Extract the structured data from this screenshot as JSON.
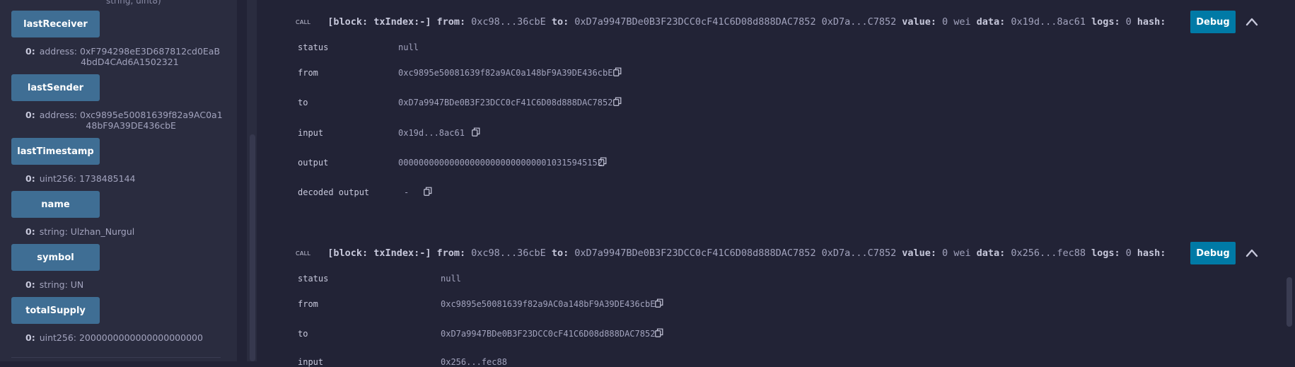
{
  "left_panel": {
    "top_cut_text": "string, uint8)",
    "functions": [
      {
        "label": "lastReceiver",
        "type_prefix": "0:",
        "output_line1": "address: 0xF794298eE3D687812cd0EaB",
        "output_line2": "4bdD4CAd6A1502321"
      },
      {
        "label": "lastSender",
        "type_prefix": "0:",
        "output_line1": "address: 0xc9895e50081639f82a9AC0a1",
        "output_line2": "48bF9A39DE436cbE"
      },
      {
        "label": "lastTimestamp",
        "type_prefix": "0:",
        "output_line1": "uint256: 1738485144"
      },
      {
        "label": "name",
        "type_prefix": "0:",
        "output_line1": "string: Ulzhan_Nurgul"
      },
      {
        "label": "symbol",
        "type_prefix": "0:",
        "output_line1": "string: UN"
      },
      {
        "label": "totalSupply",
        "type_prefix": "0:",
        "output_line1": "uint256: 2000000000000000000000"
      }
    ]
  },
  "transactions": [
    {
      "call_tag": "CALL",
      "block": "[block: txIndex:-]",
      "from_label": "from:",
      "from_short": "0xc98...36cbE",
      "to_label": "to:",
      "to_full": "0xD7a9947BDe0B3F23DCC0cF41C6D08d888DAC7852",
      "to_short": "0xD7a...C7852",
      "value_label": "value:",
      "value": "0 wei",
      "data_label": "data:",
      "data": "0x19d...8ac61",
      "logs_label": "logs:",
      "logs": "0",
      "hash_label": "hash:",
      "debug_label": "Debug",
      "rows": [
        {
          "key": "status",
          "value": "null"
        },
        {
          "key": "from",
          "value": "0xc9895e50081639f82a9AC0a148bF9A39DE436cbE"
        },
        {
          "key": "to",
          "value": "0xD7a9947BDe0B3F23DCC0cF41C6D08d888DAC7852"
        },
        {
          "key": "input",
          "value": "0x19d...8ac61"
        },
        {
          "key": "output",
          "value": "0000000000000000000000000000010315945152"
        },
        {
          "key": "decoded output",
          "value": "-"
        }
      ]
    },
    {
      "call_tag": "CALL",
      "block": "[block: txIndex:-]",
      "from_label": "from:",
      "from_short": "0xc98...36cbE",
      "to_label": "to:",
      "to_full": "0xD7a9947BDe0B3F23DCC0cF41C6D08d888DAC7852",
      "to_short": "0xD7a...C7852",
      "value_label": "value:",
      "value": "0 wei",
      "data_label": "data:",
      "data": "0x256...fec88",
      "logs_label": "logs:",
      "logs": "0",
      "hash_label": "hash:",
      "debug_label": "Debug",
      "rows": [
        {
          "key": "status",
          "value": "null"
        },
        {
          "key": "from",
          "value": "0xc9895e50081639f82a9AC0a148bF9A39DE436cbE"
        },
        {
          "key": "to",
          "value": "0xD7a9947BDe0B3F23DCC0cF41C6D08d888DAC7852"
        },
        {
          "key": "input",
          "value": "0x256...fec88"
        }
      ]
    }
  ],
  "colors": {
    "accent_button": "#3f6e94",
    "debug_button": "#007aa6",
    "background": "#222336",
    "panel": "#2a2c3f"
  }
}
